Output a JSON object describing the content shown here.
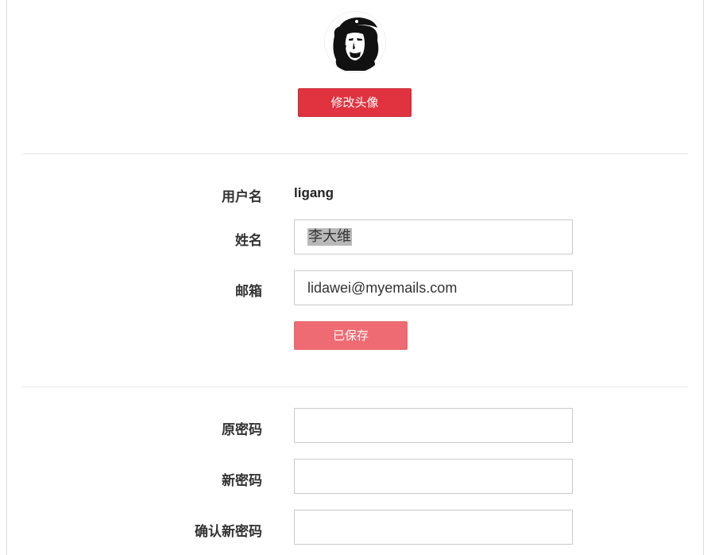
{
  "avatar": {
    "change_label": "修改头像"
  },
  "profile": {
    "username_label": "用户名",
    "username_value": "ligang",
    "name_label": "姓名",
    "name_value": "李大维",
    "email_label": "邮箱",
    "email_value": "lidawei@myemails.com",
    "save_label": "已保存"
  },
  "password": {
    "old_label": "原密码",
    "old_value": "",
    "new_label": "新密码",
    "new_value": "",
    "confirm_label": "确认新密码",
    "confirm_value": ""
  },
  "colors": {
    "primary_button": "#e0333f",
    "saved_button": "#ef6b73"
  }
}
